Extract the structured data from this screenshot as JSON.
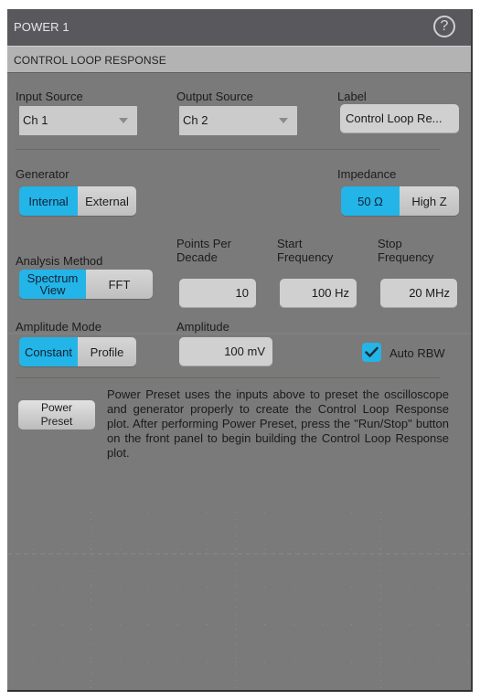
{
  "titlebar": {
    "title": "POWER 1",
    "help_icon": "help-circle-icon"
  },
  "subbar": {
    "title": "CONTROL LOOP RESPONSE"
  },
  "input_source": {
    "label": "Input Source",
    "value": "Ch 1"
  },
  "output_source": {
    "label": "Output Source",
    "value": "Ch 2"
  },
  "label_field": {
    "label": "Label",
    "value": "Control Loop Re..."
  },
  "generator": {
    "label": "Generator",
    "options": [
      "Internal",
      "External"
    ],
    "selected": "Internal"
  },
  "impedance": {
    "label": "Impedance",
    "options": [
      "50 Ω",
      "High Z"
    ],
    "selected": "50 Ω"
  },
  "analysis_method": {
    "label": "Analysis Method",
    "options": [
      "Spectrum View",
      "FFT"
    ],
    "option_lines": [
      [
        "Spectrum",
        "View"
      ],
      [
        "FFT"
      ]
    ],
    "selected": "Spectrum View"
  },
  "points_per_decade": {
    "label_lines": [
      "Points Per",
      "Decade"
    ],
    "value": "10"
  },
  "start_frequency": {
    "label_lines": [
      "Start",
      "Frequency"
    ],
    "value": "100 Hz"
  },
  "stop_frequency": {
    "label_lines": [
      "Stop",
      "Frequency"
    ],
    "value": "20 MHz"
  },
  "amplitude_mode": {
    "label": "Amplitude Mode",
    "options": [
      "Constant",
      "Profile"
    ],
    "selected": "Constant"
  },
  "amplitude": {
    "label": "Amplitude",
    "value": "100 mV"
  },
  "auto_rbw": {
    "label": "Auto RBW",
    "checked": true
  },
  "power_preset": {
    "button_lines": [
      "Power",
      "Preset"
    ],
    "description": "Power Preset uses the inputs above to preset the oscilloscope and generator properly to create the Control Loop Response plot. After performing Power Preset, press the \"Run/Stop\" button on the front panel to begin building the Control Loop Response plot."
  },
  "colors": {
    "accent": "#23b4e8",
    "panel_bg": "#7a7a7a",
    "titlebar_bg": "#59595d",
    "subbar_bg": "#b3b3b3"
  }
}
